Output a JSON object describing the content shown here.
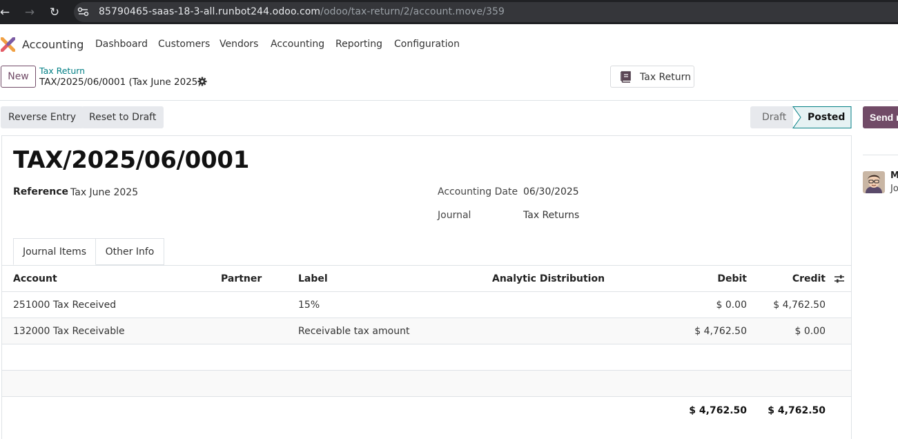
{
  "browser": {
    "url_host": "85790465-saas-18-3-all.runbot244.odoo.com",
    "url_path": "/odoo/tax-return/2/account.move/359"
  },
  "app": {
    "name": "Accounting",
    "menu": [
      "Dashboard",
      "Customers",
      "Vendors",
      "Accounting",
      "Reporting",
      "Configuration"
    ]
  },
  "control_panel": {
    "new_label": "New",
    "breadcrumb_parent": "Tax Return",
    "breadcrumb_current": "TAX/2025/06/0001 (Tax June 2025)",
    "smart_button_label": "Tax Return"
  },
  "status_bar": {
    "reverse_label": "Reverse Entry",
    "reset_label": "Reset to Draft",
    "stages": [
      "Draft",
      "Posted"
    ],
    "active_stage": "Posted",
    "send_label": "Send r"
  },
  "form": {
    "name": "TAX/2025/06/0001",
    "reference_label": "Reference",
    "reference_value": "Tax June 2025",
    "date_label": "Accounting Date",
    "date_value": "06/30/2025",
    "journal_label": "Journal",
    "journal_value": "Tax Returns",
    "tabs": [
      "Journal Items",
      "Other Info"
    ]
  },
  "lines": {
    "headers": {
      "account": "Account",
      "partner": "Partner",
      "label": "Label",
      "analytic": "Analytic Distribution",
      "debit": "Debit",
      "credit": "Credit"
    },
    "rows": [
      {
        "account": "251000 Tax Received",
        "partner": "",
        "label": "15%",
        "analytic": "",
        "debit": "$ 0.00",
        "credit": "$ 4,762.50"
      },
      {
        "account": "132000 Tax Receivable",
        "partner": "",
        "label": "Receivable tax amount",
        "analytic": "",
        "debit": "$ 4,762.50",
        "credit": "$ 0.00"
      }
    ],
    "total_debit": "$ 4,762.50",
    "total_credit": "$ 4,762.50"
  },
  "chatter": {
    "author": "M",
    "text": "Jo"
  },
  "colors": {
    "brand": "#714b67",
    "link": "#017e84",
    "browser_bg": "#202124"
  }
}
